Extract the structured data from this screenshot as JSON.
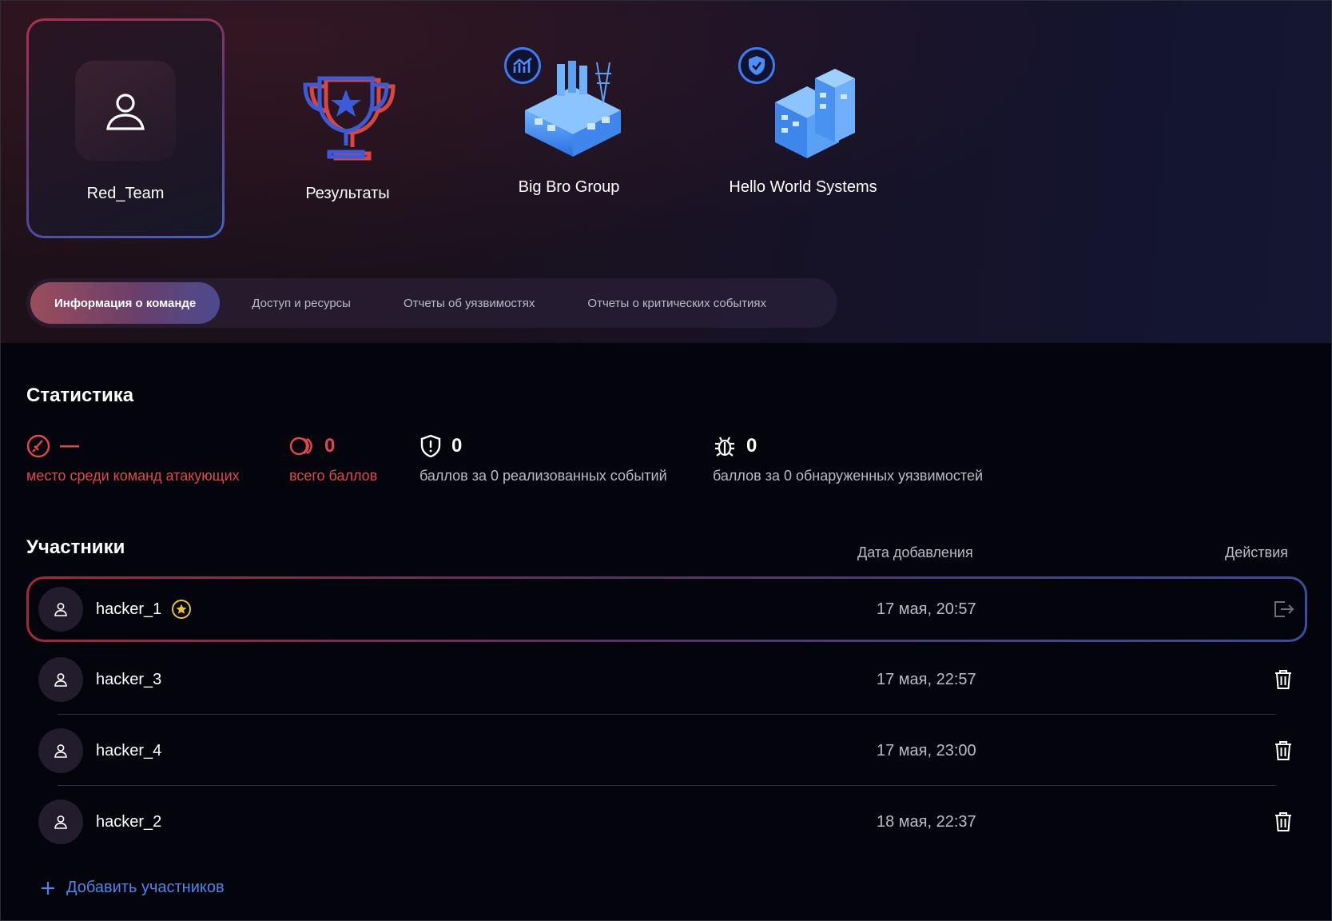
{
  "cards": [
    {
      "label": "Red_Team",
      "icon": "user-icon",
      "selected": true
    },
    {
      "label": "Результаты",
      "icon": "trophy-icon"
    },
    {
      "label": "Big Bro Group",
      "icon": "factory-icon"
    },
    {
      "label": "Hello World Systems",
      "icon": "office-building-icon"
    }
  ],
  "tabs": [
    {
      "label": "Информация о команде",
      "active": true
    },
    {
      "label": "Доступ и ресурсы"
    },
    {
      "label": "Отчеты об уязвимостях"
    },
    {
      "label": "Отчеты о критических событиях"
    }
  ],
  "statistics": {
    "title": "Статистика",
    "items": [
      {
        "icon": "sword-icon",
        "value": "—",
        "label": "место среди команд атакующих",
        "color": "#e2474b"
      },
      {
        "icon": "coins-icon",
        "value": "0",
        "label": "всего баллов",
        "color": "#e2474b"
      },
      {
        "icon": "shield-icon",
        "value": "0",
        "label": "баллов за 0 реализованных событий",
        "color": "#ffffff"
      },
      {
        "icon": "bug-icon",
        "value": "0",
        "label": "баллов за 0 обнаруженных уязвимостей",
        "color": "#ffffff"
      }
    ]
  },
  "participants": {
    "title": "Участники",
    "col_date": "Дата добавления",
    "col_actions": "Действия",
    "rows": [
      {
        "name": "hacker_1",
        "date": "17 мая, 20:57",
        "owner": true,
        "action": "leave-icon"
      },
      {
        "name": "hacker_3",
        "date": "17 мая, 22:57",
        "action": "trash-icon"
      },
      {
        "name": "hacker_4",
        "date": "17 мая, 23:00",
        "action": "trash-icon"
      },
      {
        "name": "hacker_2",
        "date": "18 мая, 22:37",
        "action": "trash-icon"
      }
    ],
    "add_label": "Добавить участников"
  },
  "colors": {
    "accent_red": "#e2474b",
    "accent_blue": "#4d86e8",
    "captain_star": "#e8c23a"
  }
}
